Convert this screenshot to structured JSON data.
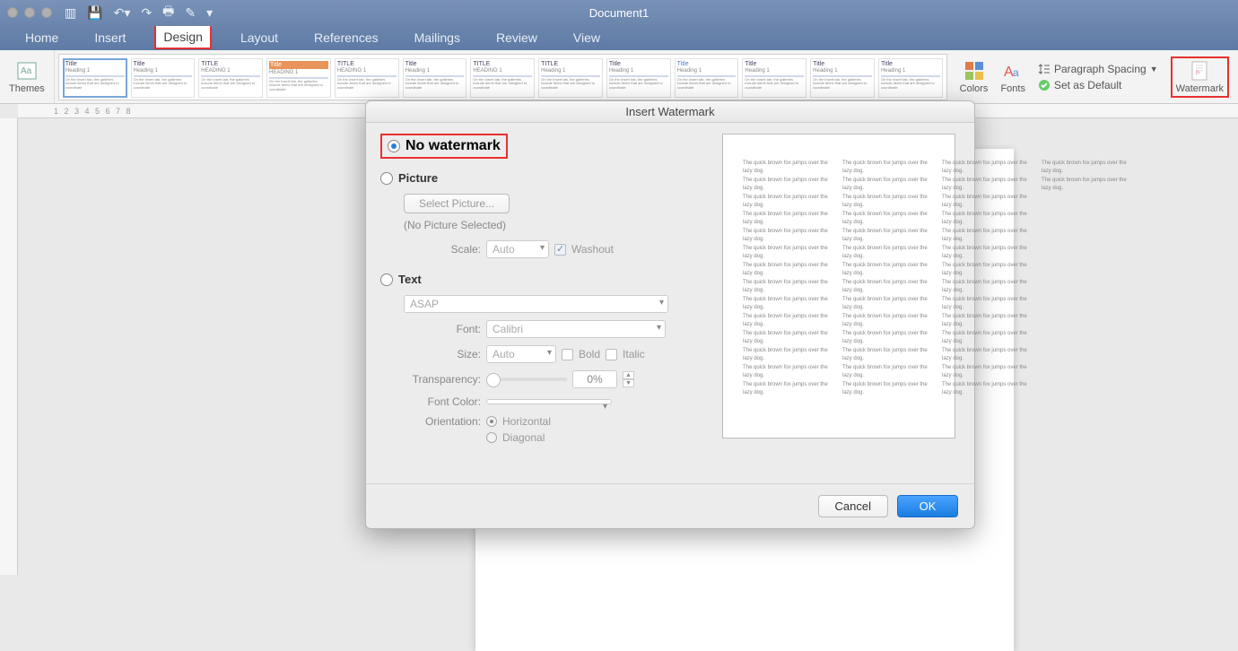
{
  "titlebar": {
    "document_title": "Document1"
  },
  "tabs": {
    "home": "Home",
    "insert": "Insert",
    "design": "Design",
    "layout": "Layout",
    "references": "References",
    "mailings": "Mailings",
    "review": "Review",
    "view": "View"
  },
  "ribbon": {
    "themes_label": "Themes",
    "colors_label": "Colors",
    "fonts_label": "Fonts",
    "paragraph_spacing_label": "Paragraph Spacing",
    "set_default_label": "Set as Default",
    "watermark_label": "Watermark",
    "gallery_items": [
      {
        "title": "Title",
        "heading": "Heading 1"
      },
      {
        "title": "Title",
        "heading": "Heading 1"
      },
      {
        "title": "TITLE",
        "heading": "HEADING 1"
      },
      {
        "title": "Title",
        "heading": "HEADING 1"
      },
      {
        "title": "TITLE",
        "heading": "HEADING 1"
      },
      {
        "title": "Title",
        "heading": "Heading 1"
      },
      {
        "title": "TITLE",
        "heading": "HEADING 1"
      },
      {
        "title": "TITLE",
        "heading": "Heading 1"
      },
      {
        "title": "Title",
        "heading": "Heading 1"
      },
      {
        "title": "Title",
        "heading": "Heading 1"
      },
      {
        "title": "Title",
        "heading": "Heading 1"
      },
      {
        "title": "Title",
        "heading": "Heading 1"
      },
      {
        "title": "Title",
        "heading": "Heading 1"
      }
    ]
  },
  "dialog": {
    "title": "Insert Watermark",
    "no_watermark_label": "No watermark",
    "picture_label": "Picture",
    "select_picture_btn": "Select Picture...",
    "no_picture_note": "(No Picture Selected)",
    "scale_label": "Scale:",
    "scale_value": "Auto",
    "washout_label": "Washout",
    "text_label": "Text",
    "text_value": "ASAP",
    "font_label": "Font:",
    "font_value": "Calibri",
    "size_label": "Size:",
    "size_value": "Auto",
    "bold_label": "Bold",
    "italic_label": "Italic",
    "transparency_label": "Transparency:",
    "transparency_value": "0%",
    "font_color_label": "Font Color:",
    "orientation_label": "Orientation:",
    "orientation_horizontal": "Horizontal",
    "orientation_diagonal": "Diagonal",
    "cancel_btn": "Cancel",
    "ok_btn": "OK",
    "preview_line": "The quick brown fox jumps over the lazy dog."
  },
  "ruler": {
    "marks": "1        2        3        4        5        6        7        8"
  }
}
